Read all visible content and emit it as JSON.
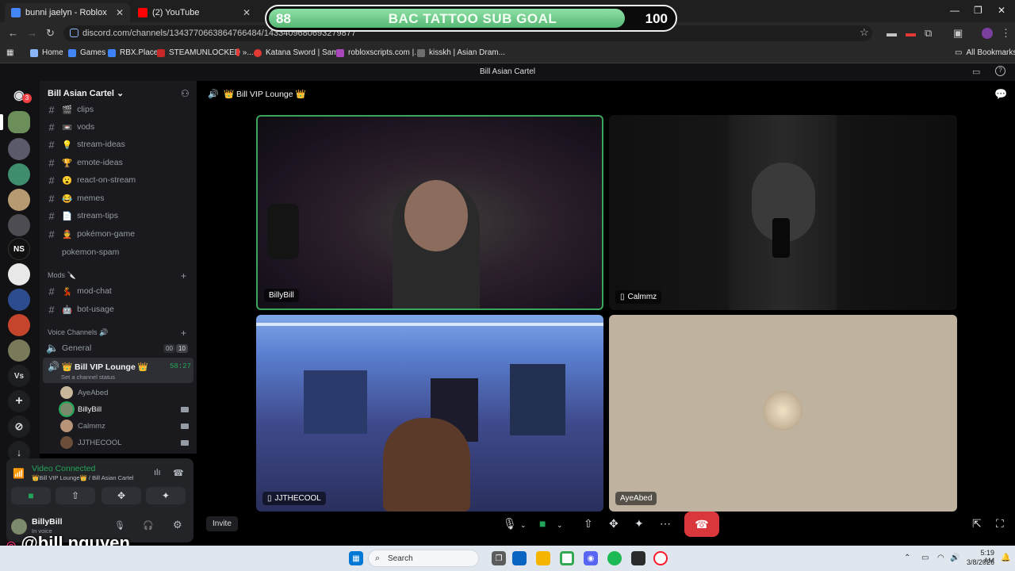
{
  "browser": {
    "tabs": [
      {
        "title": "bunni jaelyn - Roblox",
        "color": "#4285f4"
      },
      {
        "title": "(2) YouTube",
        "color": "#ff0000"
      }
    ],
    "url": "discord.com/channels/1343770663864766484/1433409680693279877",
    "bookmarks": [
      {
        "label": "Home",
        "color": "#8ab4f8"
      },
      {
        "label": "Games",
        "color": "#4285f4"
      },
      {
        "label": "RBX.Place",
        "color": "#3b82f6"
      },
      {
        "label": "STEAMUNLOCKED »...",
        "color": "#c62828"
      },
      {
        "label": "Katana Sword | Sam...",
        "color": "#e53935"
      },
      {
        "label": "robloxscripts.com |...",
        "color": "#ab47bc"
      },
      {
        "label": "kisskh | Asian Dram...",
        "color": "#6d6d6d"
      }
    ],
    "all_bookmarks": "All Bookmarks"
  },
  "subgoal": {
    "current": "88",
    "title": "BAC TATTOO SUB GOAL",
    "target": "100",
    "progress": 0.88
  },
  "discord": {
    "window_title": "Bill Asian Cartel",
    "mention_badge": "3",
    "server_name": "Bill Asian Cartel",
    "channels": [
      {
        "name": "clips",
        "emoji": "🎬"
      },
      {
        "name": "vods",
        "emoji": "📼"
      },
      {
        "name": "stream-ideas",
        "emoji": "💡"
      },
      {
        "name": "emote-ideas",
        "emoji": "🏆"
      },
      {
        "name": "react-on-stream",
        "emoji": "😮"
      },
      {
        "name": "memes",
        "emoji": "😂"
      },
      {
        "name": "stream-tips",
        "emoji": "📄"
      },
      {
        "name": "pokémon-game",
        "emoji": "👲"
      },
      {
        "name": "pokemon-spam",
        "emoji": ""
      }
    ],
    "mods_category": "Mods 🔪",
    "mod_channels": [
      {
        "name": "mod-chat",
        "emoji": "💃"
      },
      {
        "name": "bot-usage",
        "emoji": "🤖"
      }
    ],
    "voice_category": "Voice Channels 🔊",
    "voice_general": {
      "name": "General",
      "user_count": "00",
      "user_limit": "10"
    },
    "voice_active": {
      "name": "👑 Bill VIP Lounge 👑",
      "timer": "58:27",
      "status": "Set a channel status"
    },
    "voice_members": [
      "AyeAbed",
      "BillyBill",
      "Calmmz",
      "JJTHECOOL"
    ],
    "connection": {
      "status": "Video Connected",
      "location": "👑Bill VIP Lounge👑 / Bill Asian Cartel"
    },
    "user": {
      "name": "BillyBill",
      "status": "In voice"
    },
    "call_header": "👑 Bill VIP Lounge 👑",
    "tiles": [
      "BillyBill",
      "Calmmz",
      "JJTHECOOL",
      "AyeAbed"
    ],
    "invite_label": "Invite"
  },
  "overlay_handle": "@bill.nguyen",
  "taskbar": {
    "search_placeholder": "Search",
    "time": "5:19 AM",
    "date": "3/8/2026"
  }
}
